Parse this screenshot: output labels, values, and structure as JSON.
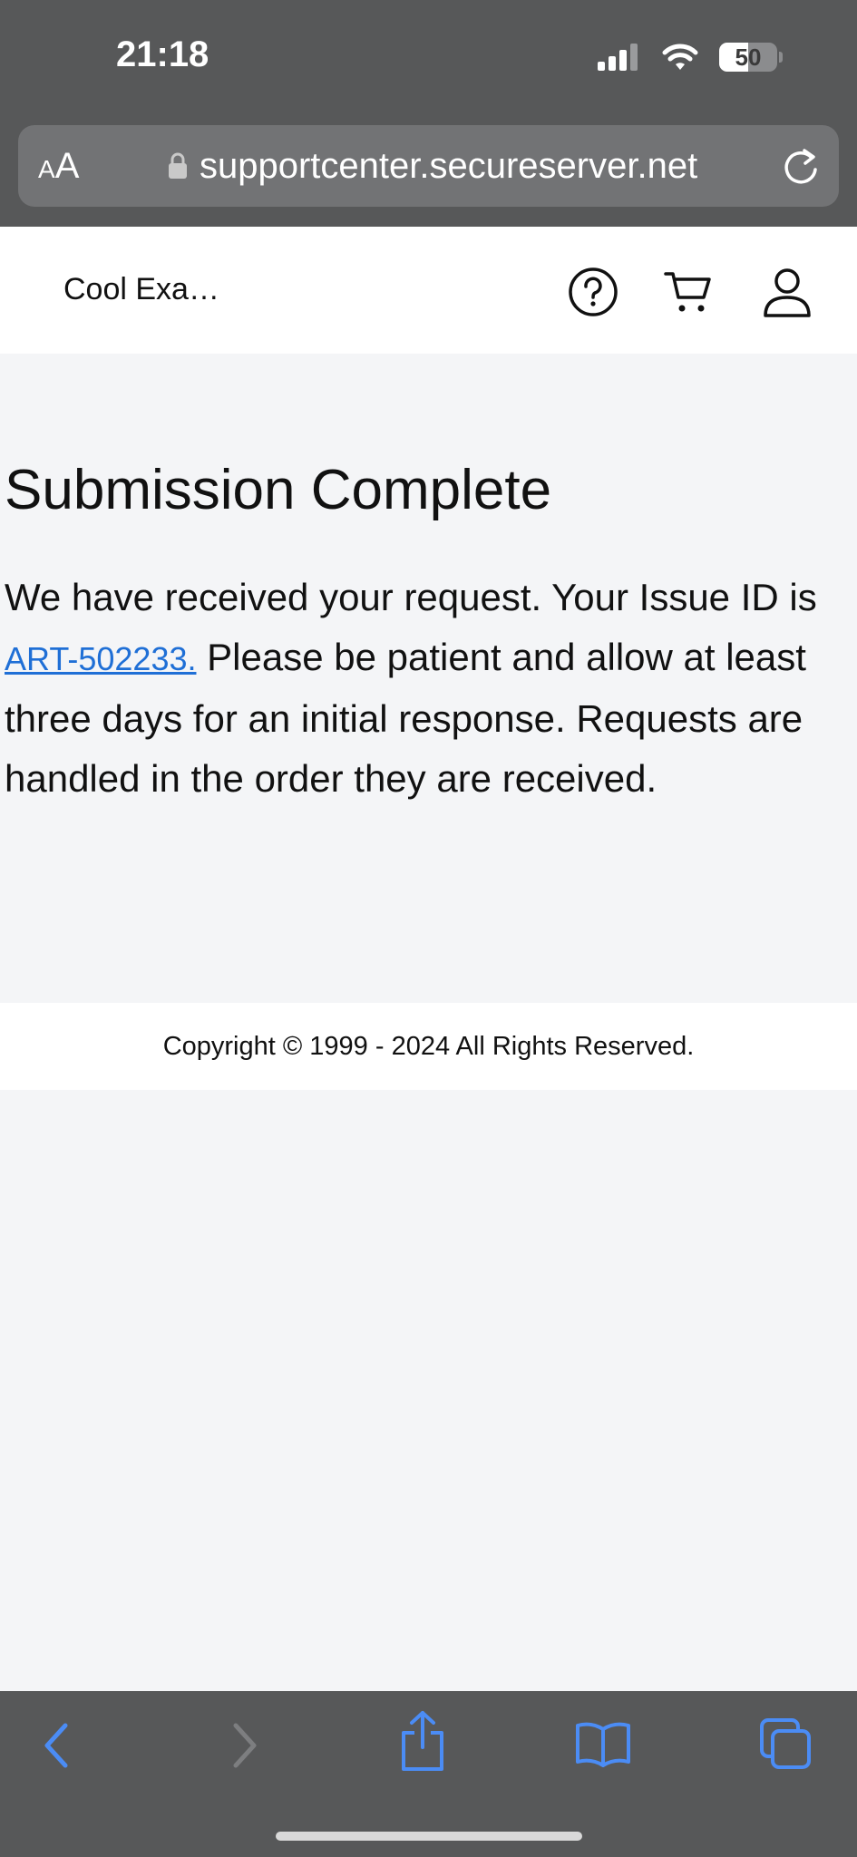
{
  "status_bar": {
    "time": "21:18",
    "battery_percent": "50",
    "icons": [
      "signal-icon",
      "wifi-icon",
      "battery-icon"
    ]
  },
  "browser": {
    "aa_label_small": "A",
    "aa_label_large": "A",
    "url": "supportcenter.secureserver.net",
    "icons": [
      "lock-icon",
      "reload-icon"
    ]
  },
  "site_header": {
    "site_name": "Cool Exa…",
    "icons": [
      "help-icon",
      "cart-icon",
      "account-icon"
    ]
  },
  "main": {
    "title": "Submission Complete",
    "message_before": "We have received your request. Your Issue ID is ",
    "issue_id": "ART-502233.",
    "message_after": " Please be patient and allow at least three days for an initial response. Requests are handled in the order they are received."
  },
  "footer": {
    "copyright": "Copyright © 1999 - 2024 All Rights Reserved."
  },
  "toolbar": {
    "icons": [
      "back-icon",
      "forward-icon",
      "share-icon",
      "bookmarks-icon",
      "tabs-icon"
    ]
  },
  "colors": {
    "chrome_bg": "#575859",
    "page_bg": "#f4f5f7",
    "link": "#1f6fd6",
    "toolbar_active": "#4b8cf5"
  }
}
